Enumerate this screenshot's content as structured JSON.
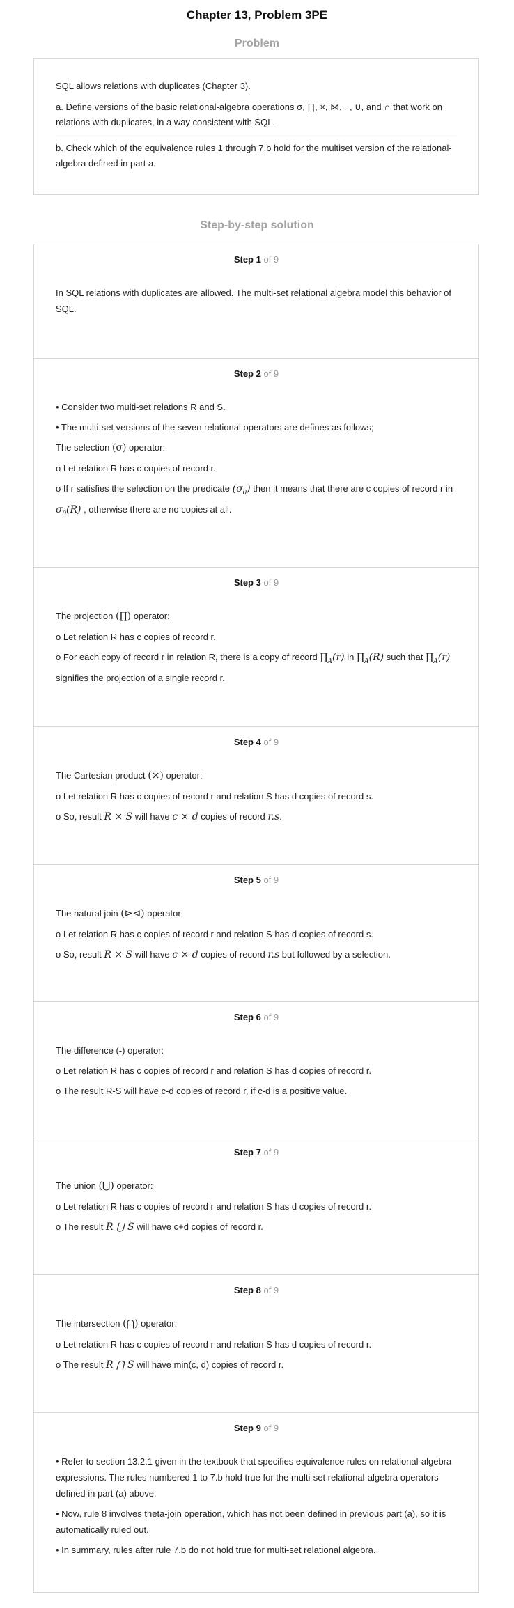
{
  "page_title": "Chapter 13, Problem 3PE",
  "problem_heading": "Problem",
  "problem": {
    "lines": [
      "SQL allows relations with duplicates (Chapter 3).",
      "a. Define versions of the basic relational-algebra operations σ, ∏, ×, ⋈, −, ∪, and ∩ that work on relations with duplicates, in a way consistent with SQL.",
      "b. Check which of the equivalence rules 1 through 7.b hold for the multiset version of the relational-algebra defined in part a."
    ]
  },
  "solution_heading": "Step-by-step solution",
  "step_word": "Step",
  "of_text": "of 9",
  "steps": [
    {
      "number": "1",
      "lines": [
        "In SQL relations with duplicates are allowed. The multi-set relational algebra model this behavior of SQL."
      ]
    },
    {
      "number": "2",
      "lines": [
        "• Consider two multi-set relations R and S.",
        "• The multi-set versions of the seven relational operators are defines as follows;",
        [
          "The selection ",
          "(σ)",
          " operator:"
        ],
        "o Let relation R has c copies of record r.",
        [
          "o If r satisfies the selection on the predicate ",
          "(σθ)",
          " then it means that there are c copies of record r in ",
          "σθ(R)",
          " , otherwise there are no copies at all."
        ]
      ]
    },
    {
      "number": "3",
      "lines": [
        [
          "The projection ",
          "(∏)",
          " operator:"
        ],
        "o Let relation R has c copies of record r.",
        [
          "o For each copy of record r in relation R, there is a copy of record ",
          "∏A(r)",
          " in ",
          "∏A(R)",
          " such that ",
          "∏A(r)",
          " signifies the projection of a single record r."
        ]
      ]
    },
    {
      "number": "4",
      "lines": [
        [
          "The Cartesian product ",
          "(×)",
          " operator:"
        ],
        "o Let relation R has c copies of record r and relation S has d copies of record s.",
        [
          "o So, result ",
          "R × S",
          " will have ",
          "c × d",
          " copies of record ",
          "r.s",
          "."
        ]
      ]
    },
    {
      "number": "5",
      "lines": [
        [
          "The natural join ",
          "(⊳⊲)",
          " operator:"
        ],
        "o Let relation R has c copies of record r and relation S has d copies of record s.",
        [
          "o So, result ",
          "R × S",
          " will have ",
          "c × d",
          " copies of record ",
          "r.s",
          " but followed by a selection."
        ]
      ]
    },
    {
      "number": "6",
      "lines": [
        "The difference (-) operator:",
        "o Let relation R has c copies of record r and relation S has d copies of record r.",
        "o The result R-S will have c-d copies of record r, if c-d is a positive value."
      ]
    },
    {
      "number": "7",
      "lines": [
        [
          "The union ",
          "(⋃)",
          " operator:"
        ],
        "o Let relation R has c copies of record r and relation S has d copies of record r.",
        [
          "o The result ",
          "R ⋃ S",
          " will have c+d copies of record r."
        ]
      ]
    },
    {
      "number": "8",
      "lines": [
        [
          "The intersection ",
          "(⋂)",
          " operator:"
        ],
        "o Let relation R has c copies of record r and relation S has d copies of record r.",
        [
          "o The result ",
          "R ⋂ S",
          " will have min(c, d) copies of record r."
        ]
      ]
    },
    {
      "number": "9",
      "lines": [
        "• Refer to section 13.2.1 given in the textbook that specifies equivalence rules on relational-algebra expressions. The rules numbered 1 to 7.b hold true for the multi-set relational-algebra operators defined in part (a) above.",
        "• Now, rule 8 involves theta-join operation, which has not been defined in previous part (a), so it is automatically ruled out.",
        "• In summary, rules after rule 7.b do not hold true for multi-set relational algebra."
      ]
    }
  ]
}
